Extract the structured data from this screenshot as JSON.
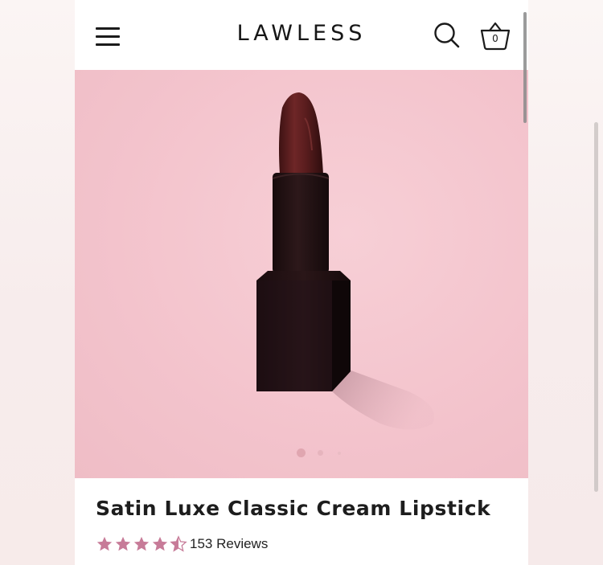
{
  "header": {
    "logo": "LAWLESS",
    "cart_count": "0",
    "menu_icon": "hamburger-menu-icon",
    "search_icon": "search-icon",
    "cart_icon": "basket-icon"
  },
  "carousel": {
    "image_subject": "lipstick",
    "slide_count": 3,
    "active_slide": 1
  },
  "product": {
    "title": "Satin Luxe Classic Cream Lipstick",
    "rating": 4.5,
    "rating_max": 5,
    "reviews_label": "153 Reviews"
  },
  "colors": {
    "hero_background": "#f3c3cc",
    "star_color": "#c77b98",
    "lipstick_bullet": "#5a1e1e",
    "lipstick_case": "#241416"
  }
}
